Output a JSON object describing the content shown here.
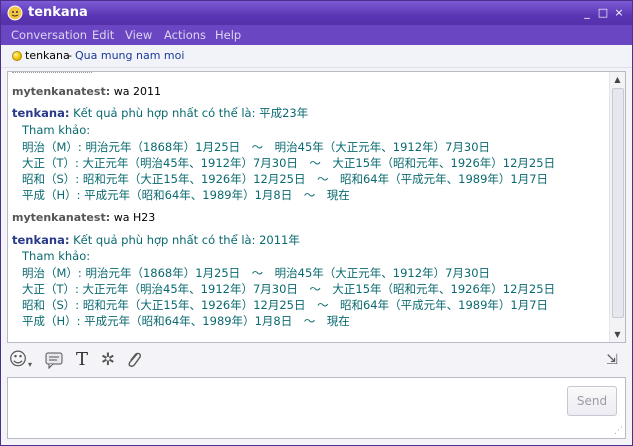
{
  "window": {
    "title": "tenkana",
    "controls": [
      "_",
      "□",
      "×"
    ]
  },
  "menu": [
    "Conversation",
    "Edit",
    "View",
    "Actions",
    "Help"
  ],
  "contact": {
    "name": "tenkana",
    "separator": "-",
    "status_message": "Qua mung nam moi"
  },
  "messages": [
    {
      "sender": "mytenkanatest:",
      "text": "wa 2011"
    },
    {
      "sender": "tenkana:",
      "text": "Kết quả phù hợp nhất có thể là: 平成23年",
      "lines": [
        "Tham khảo:",
        "明治（M）: 明治元年（1868年）1月25日　～　明治45年（大正元年、1912年）7月30日",
        "大正（T）: 大正元年（明治45年、1912年）7月30日　～　大正15年（昭和元年、1926年）12月25日",
        "昭和（S）: 昭和元年（大正15年、1926年）12月25日　～　昭和64年（平成元年、1989年）1月7日",
        "平成（H）: 平成元年（昭和64年、1989年）1月8日　～　現在"
      ]
    },
    {
      "sender": "mytenkanatest:",
      "text": "wa H23"
    },
    {
      "sender": "tenkana:",
      "text": "Kết quả phù hợp nhất có thể là: 2011年",
      "lines": [
        "Tham khảo:",
        "明治（M）: 明治元年（1868年）1月25日　～　明治45年（大正元年、1912年）7月30日",
        "大正（T）: 大正元年（明治45年、1912年）7月30日　～　大正15年（昭和元年、1926年）12月25日",
        "昭和（S）: 昭和元年（大正15年、1926年）12月25日　～　昭和64年（平成元年、1989年）1月7日",
        "平成（H）: 平成元年（昭和64年、1989年）1月8日　～　現在"
      ]
    }
  ],
  "toolbar": {
    "emoticon_icon": "☺",
    "wink_icon": "▾",
    "font_icon": "T",
    "settings_icon": "✲",
    "attach_icon": "⌀",
    "contact_icon": "⇲"
  },
  "input": {
    "value": "",
    "send_label": "Send"
  },
  "colors": {
    "titlebar": "#5a36b4",
    "menubar": "#6a46c2",
    "bot_name": "#2a3a8a",
    "bot_text": "#0a6a70"
  }
}
